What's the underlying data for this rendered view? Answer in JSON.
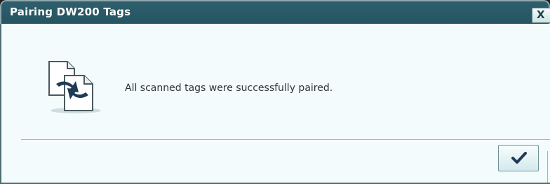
{
  "dialog": {
    "title": "Pairing DW200 Tags",
    "close_label": "X",
    "message": "All scanned tags were successfully paired.",
    "icon": "document-swap-icon",
    "ok_icon": "checkmark-icon"
  },
  "colors": {
    "titlebar": "#2a5a66",
    "body": "#f3fbfc",
    "accent": "#1e3a55"
  }
}
